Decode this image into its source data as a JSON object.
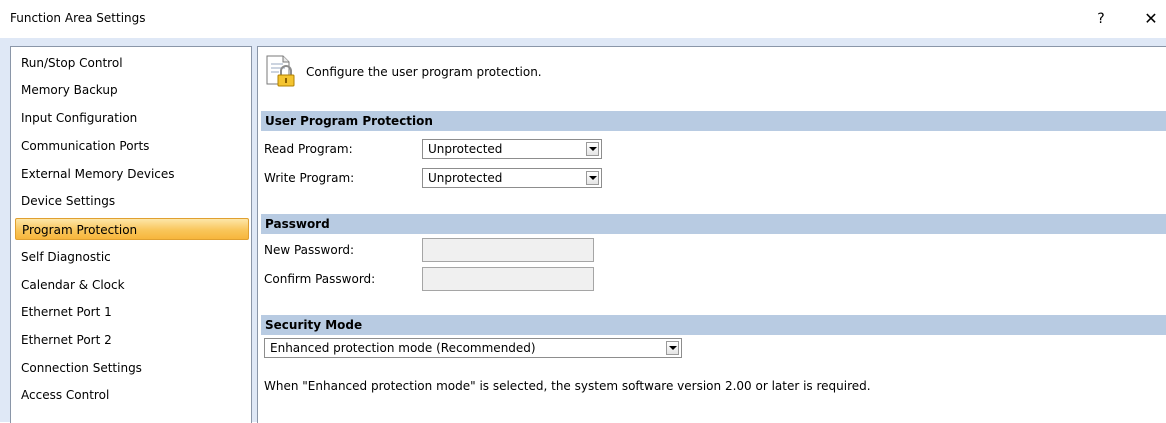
{
  "window": {
    "title": "Function Area Settings",
    "help_glyph": "?",
    "close_glyph": "✕"
  },
  "sidebar": {
    "items": [
      {
        "label": "Run/Stop Control"
      },
      {
        "label": "Memory Backup"
      },
      {
        "label": "Input Configuration"
      },
      {
        "label": "Communication Ports"
      },
      {
        "label": "External Memory Devices"
      },
      {
        "label": "Device Settings"
      },
      {
        "label": "Program Protection",
        "selected": true
      },
      {
        "label": "Self Diagnostic"
      },
      {
        "label": "Calendar & Clock"
      },
      {
        "label": "Ethernet Port 1"
      },
      {
        "label": "Ethernet Port 2"
      },
      {
        "label": "Connection Settings"
      },
      {
        "label": "Access Control"
      }
    ]
  },
  "main": {
    "header_icon": "lock-document-icon",
    "header_text": "Configure the user program protection.",
    "user_program_protection": {
      "title": "User Program Protection",
      "read_program_label": "Read Program:",
      "read_program_value": "Unprotected",
      "write_program_label": "Write Program:",
      "write_program_value": "Unprotected"
    },
    "password": {
      "title": "Password",
      "new_password_label": "New Password:",
      "new_password_value": "",
      "confirm_password_label": "Confirm Password:",
      "confirm_password_value": ""
    },
    "security_mode": {
      "title": "Security Mode",
      "value": "Enhanced protection mode (Recommended)",
      "note": "When \"Enhanced protection mode\" is selected, the system software version 2.00 or later is required."
    }
  },
  "colors": {
    "section_header_bg": "#b8cbe2",
    "selected_item": "#f9c65b",
    "frame_bg": "#dfe8f6"
  }
}
